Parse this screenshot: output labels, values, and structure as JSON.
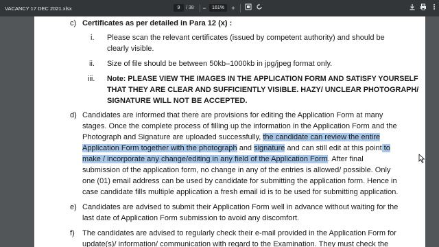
{
  "toolbar": {
    "filename": "VACANCY 17 DEC 2021.xlsx",
    "page_current": "9",
    "page_total": "/ 38",
    "zoom": "161%",
    "zoom_out": "−",
    "zoom_in": "+"
  },
  "doc": {
    "c_label": "c)",
    "c_heading": "Certificates as per detailed in Para 12 (x) :",
    "i_label": "i.",
    "i_line1": "Please scan the relevant certificates (issued by competent authority) and should be",
    "i_line2": "clearly visible.",
    "ii_label": "ii.",
    "ii_line1": "Size of file should be between 50kb–1000kb in jpg/jpeg format only.",
    "iii_label": "iii.",
    "iii_line1": "Note: PLEASE VIEW THE IMAGES IN THE APPLICATION FORM AND SATISFY YOURSELF",
    "iii_line2": "THAT THEY ARE CLEAR AND SUFFICIENTLY VISIBLE. HAZY/ UNCLEAR PHOTOGRAPH/",
    "iii_line3": "SIGNATURE WILL NOT BE ACCEPTED.",
    "d_label": "d)",
    "d_line1": "Candidates are informed that there are provisions for editing the Application Form at many",
    "d_line2": "stages. Once the complete process of filling up the information in the Application Form and the",
    "d_line3a": "Photograph and Signature are uploaded successfully, ",
    "d_line3b": "the candidate can review the entire",
    "d_line4a": "Application Form together with the photograph",
    "d_line4b": " and ",
    "d_line4c": "signature",
    "d_line4d": " and can still edit at this point",
    "d_line4e": " to",
    "d_line5a": "make / incorporate any change/editing in any field of the Application Form",
    "d_line5b": ". After final",
    "d_line6": "submission of the application form, no change in any of the entries is allowed/ possible. Only",
    "d_line7": "one (01) email address can be used by candidate for submitting the application form. Hence in",
    "d_line8": "case candidate fills multiple application a fresh email id is to be used for submitting application.",
    "e_label": "e)",
    "e_line1": "Candidates are advised to submit their Application Form well in advance without waiting for the",
    "e_line2": "last date of Application Form submission to avoid any discomfort.",
    "f_label": "f)",
    "f_line1": "The candidates are advised to regularly check their e-mail provided in the Application Form for",
    "f_line2": "update(s)/ information/ communication with regard to the Examination. They must check the"
  },
  "colors": {
    "toolbar": "#323639",
    "viewer": "#525659",
    "highlight": "#a9c7e8"
  },
  "icons": [
    "menu-icon",
    "fit-page-icon",
    "rotate-icon",
    "download-icon",
    "print-icon",
    "more-icon"
  ]
}
